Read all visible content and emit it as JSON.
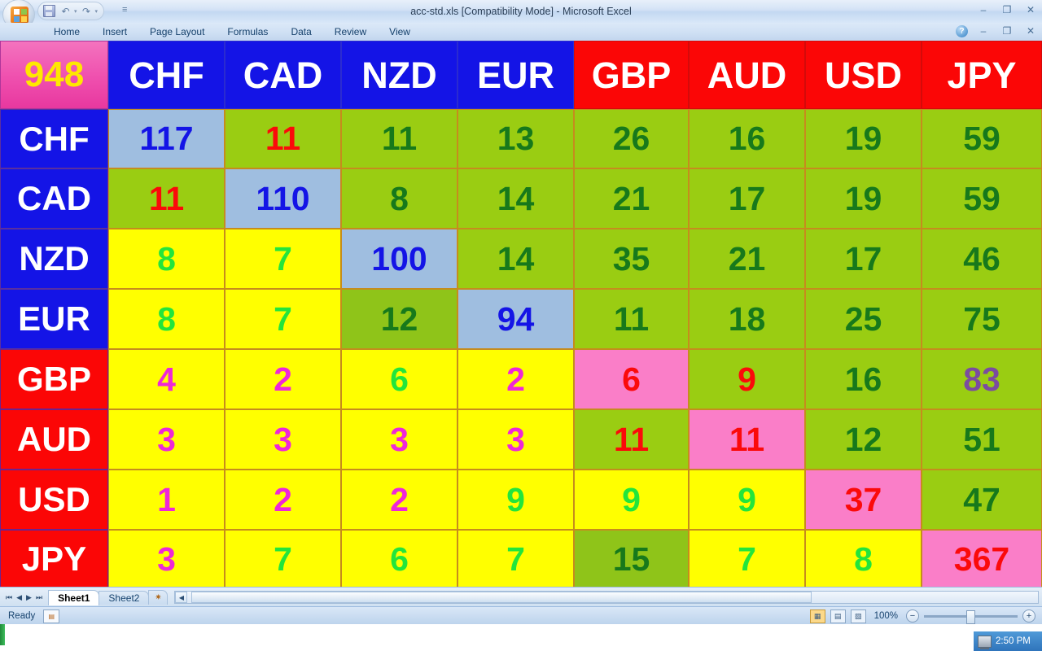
{
  "window": {
    "title": "acc-std.xls  [Compatibility Mode] - Microsoft Excel",
    "minimize": "–",
    "restore": "❐",
    "close": "✕",
    "help": "?"
  },
  "quick_access": {
    "save": "💾",
    "undo": "↶",
    "redo": "↷",
    "dropdown": "▾",
    "customize": "≡"
  },
  "ribbon": {
    "tabs": [
      {
        "label": "Home",
        "active": false
      },
      {
        "label": "Insert",
        "active": false
      },
      {
        "label": "Page Layout",
        "active": false
      },
      {
        "label": "Formulas",
        "active": false
      },
      {
        "label": "Data",
        "active": false
      },
      {
        "label": "Review",
        "active": false
      },
      {
        "label": "View",
        "active": false
      }
    ]
  },
  "chart_data": {
    "type": "table",
    "title": "948",
    "corner_label": "948",
    "categories": [
      "CHF",
      "CAD",
      "NZD",
      "EUR",
      "GBP",
      "AUD",
      "USD",
      "JPY"
    ],
    "column_headers": [
      "CHF",
      "CAD",
      "NZD",
      "EUR",
      "GBP",
      "AUD",
      "USD",
      "JPY"
    ],
    "row_headers": [
      "CHF",
      "CAD",
      "NZD",
      "EUR",
      "GBP",
      "AUD",
      "USD",
      "JPY"
    ],
    "series": [
      {
        "name": "CHF",
        "values": [
          117,
          11,
          11,
          13,
          26,
          16,
          19,
          59
        ]
      },
      {
        "name": "CAD",
        "values": [
          11,
          110,
          8,
          14,
          21,
          17,
          19,
          59
        ]
      },
      {
        "name": "NZD",
        "values": [
          8,
          7,
          100,
          14,
          35,
          21,
          17,
          46
        ]
      },
      {
        "name": "EUR",
        "values": [
          8,
          7,
          12,
          94,
          11,
          18,
          25,
          75
        ]
      },
      {
        "name": "GBP",
        "values": [
          4,
          2,
          6,
          2,
          6,
          9,
          16,
          83
        ]
      },
      {
        "name": "AUD",
        "values": [
          3,
          3,
          3,
          3,
          11,
          11,
          12,
          51
        ]
      },
      {
        "name": "USD",
        "values": [
          1,
          2,
          2,
          9,
          9,
          9,
          37,
          47
        ]
      },
      {
        "name": "JPY",
        "values": [
          3,
          7,
          6,
          7,
          15,
          7,
          8,
          367
        ]
      }
    ],
    "xlabel": "",
    "ylabel": "",
    "grid": true,
    "legend": "none"
  },
  "sheet": {
    "corner": {
      "text": "948",
      "bg": "#ef4fae",
      "fg": "#ffe800"
    },
    "col_headers": [
      {
        "text": "CHF",
        "bg": "#1414e6",
        "fg": "#ffffff"
      },
      {
        "text": "CAD",
        "bg": "#1414e6",
        "fg": "#ffffff"
      },
      {
        "text": "NZD",
        "bg": "#1414e6",
        "fg": "#ffffff"
      },
      {
        "text": "EUR",
        "bg": "#1414e6",
        "fg": "#ffffff"
      },
      {
        "text": "GBP",
        "bg": "#fb0606",
        "fg": "#ffffff"
      },
      {
        "text": "AUD",
        "bg": "#fb0606",
        "fg": "#ffffff"
      },
      {
        "text": "USD",
        "bg": "#fb0606",
        "fg": "#ffffff"
      },
      {
        "text": "JPY",
        "bg": "#fb0606",
        "fg": "#ffffff"
      }
    ],
    "rows": [
      {
        "header": {
          "text": "CHF",
          "bg": "#1414e6",
          "fg": "#ffffff"
        },
        "cells": [
          {
            "v": "117",
            "bg": "bg-blue",
            "fg": "t-blue"
          },
          {
            "v": "11",
            "bg": "bg-green",
            "fg": "t-red"
          },
          {
            "v": "11",
            "bg": "bg-green",
            "fg": "t-dgreen"
          },
          {
            "v": "13",
            "bg": "bg-green",
            "fg": "t-dgreen"
          },
          {
            "v": "26",
            "bg": "bg-green",
            "fg": "t-dgreen"
          },
          {
            "v": "16",
            "bg": "bg-green",
            "fg": "t-dgreen"
          },
          {
            "v": "19",
            "bg": "bg-green",
            "fg": "t-dgreen"
          },
          {
            "v": "59",
            "bg": "bg-green",
            "fg": "t-dgreen"
          }
        ]
      },
      {
        "header": {
          "text": "CAD",
          "bg": "#1414e6",
          "fg": "#ffffff"
        },
        "cells": [
          {
            "v": "11",
            "bg": "bg-green",
            "fg": "t-red"
          },
          {
            "v": "110",
            "bg": "bg-blue",
            "fg": "t-blue"
          },
          {
            "v": "8",
            "bg": "bg-green",
            "fg": "t-dgreen"
          },
          {
            "v": "14",
            "bg": "bg-green",
            "fg": "t-dgreen"
          },
          {
            "v": "21",
            "bg": "bg-green",
            "fg": "t-dgreen"
          },
          {
            "v": "17",
            "bg": "bg-green",
            "fg": "t-dgreen"
          },
          {
            "v": "19",
            "bg": "bg-green",
            "fg": "t-dgreen"
          },
          {
            "v": "59",
            "bg": "bg-green",
            "fg": "t-dgreen"
          }
        ]
      },
      {
        "header": {
          "text": "NZD",
          "bg": "#1414e6",
          "fg": "#ffffff"
        },
        "cells": [
          {
            "v": "8",
            "bg": "bg-yellow",
            "fg": "t-lgreen"
          },
          {
            "v": "7",
            "bg": "bg-yellow",
            "fg": "t-lgreen"
          },
          {
            "v": "100",
            "bg": "bg-blue",
            "fg": "t-blue"
          },
          {
            "v": "14",
            "bg": "bg-green",
            "fg": "t-dgreen"
          },
          {
            "v": "35",
            "bg": "bg-green",
            "fg": "t-dgreen"
          },
          {
            "v": "21",
            "bg": "bg-green",
            "fg": "t-dgreen"
          },
          {
            "v": "17",
            "bg": "bg-green",
            "fg": "t-dgreen"
          },
          {
            "v": "46",
            "bg": "bg-green",
            "fg": "t-dgreen"
          }
        ]
      },
      {
        "header": {
          "text": "EUR",
          "bg": "#1414e6",
          "fg": "#ffffff"
        },
        "cells": [
          {
            "v": "8",
            "bg": "bg-yellow",
            "fg": "t-lgreen"
          },
          {
            "v": "7",
            "bg": "bg-yellow",
            "fg": "t-lgreen"
          },
          {
            "v": "12",
            "bg": "bg-green2",
            "fg": "t-dgreen"
          },
          {
            "v": "94",
            "bg": "bg-blue",
            "fg": "t-blue"
          },
          {
            "v": "11",
            "bg": "bg-green",
            "fg": "t-dgreen"
          },
          {
            "v": "18",
            "bg": "bg-green",
            "fg": "t-dgreen"
          },
          {
            "v": "25",
            "bg": "bg-green",
            "fg": "t-dgreen"
          },
          {
            "v": "75",
            "bg": "bg-green",
            "fg": "t-dgreen"
          }
        ]
      },
      {
        "header": {
          "text": "GBP",
          "bg": "#fb0606",
          "fg": "#ffffff"
        },
        "cells": [
          {
            "v": "4",
            "bg": "bg-yellow",
            "fg": "t-magenta"
          },
          {
            "v": "2",
            "bg": "bg-yellow",
            "fg": "t-magenta"
          },
          {
            "v": "6",
            "bg": "bg-yellow",
            "fg": "t-lgreen"
          },
          {
            "v": "2",
            "bg": "bg-yellow",
            "fg": "t-magenta"
          },
          {
            "v": "6",
            "bg": "bg-pink",
            "fg": "t-red"
          },
          {
            "v": "9",
            "bg": "bg-green",
            "fg": "t-red"
          },
          {
            "v": "16",
            "bg": "bg-green",
            "fg": "t-dgreen"
          },
          {
            "v": "83",
            "bg": "bg-green",
            "fg": "t-purple"
          }
        ]
      },
      {
        "header": {
          "text": "AUD",
          "bg": "#fb0606",
          "fg": "#ffffff"
        },
        "cells": [
          {
            "v": "3",
            "bg": "bg-yellow",
            "fg": "t-magenta"
          },
          {
            "v": "3",
            "bg": "bg-yellow",
            "fg": "t-magenta"
          },
          {
            "v": "3",
            "bg": "bg-yellow",
            "fg": "t-magenta"
          },
          {
            "v": "3",
            "bg": "bg-yellow",
            "fg": "t-magenta"
          },
          {
            "v": "11",
            "bg": "bg-green",
            "fg": "t-red"
          },
          {
            "v": "11",
            "bg": "bg-pink",
            "fg": "t-red"
          },
          {
            "v": "12",
            "bg": "bg-green",
            "fg": "t-dgreen"
          },
          {
            "v": "51",
            "bg": "bg-green",
            "fg": "t-dgreen"
          }
        ]
      },
      {
        "header": {
          "text": "USD",
          "bg": "#fb0606",
          "fg": "#ffffff"
        },
        "cells": [
          {
            "v": "1",
            "bg": "bg-yellow",
            "fg": "t-magenta"
          },
          {
            "v": "2",
            "bg": "bg-yellow",
            "fg": "t-magenta"
          },
          {
            "v": "2",
            "bg": "bg-yellow",
            "fg": "t-magenta"
          },
          {
            "v": "9",
            "bg": "bg-yellow",
            "fg": "t-lgreen"
          },
          {
            "v": "9",
            "bg": "bg-yellow",
            "fg": "t-lgreen"
          },
          {
            "v": "9",
            "bg": "bg-yellow",
            "fg": "t-lgreen"
          },
          {
            "v": "37",
            "bg": "bg-pink",
            "fg": "t-red"
          },
          {
            "v": "47",
            "bg": "bg-green",
            "fg": "t-dgreen"
          }
        ]
      },
      {
        "header": {
          "text": "JPY",
          "bg": "#fb0606",
          "fg": "#ffffff"
        },
        "cells": [
          {
            "v": "3",
            "bg": "bg-yellow",
            "fg": "t-magenta"
          },
          {
            "v": "7",
            "bg": "bg-yellow",
            "fg": "t-lgreen"
          },
          {
            "v": "6",
            "bg": "bg-yellow",
            "fg": "t-lgreen"
          },
          {
            "v": "7",
            "bg": "bg-yellow",
            "fg": "t-lgreen"
          },
          {
            "v": "15",
            "bg": "bg-green2",
            "fg": "t-dgreen"
          },
          {
            "v": "7",
            "bg": "bg-yellow",
            "fg": "t-lgreen"
          },
          {
            "v": "8",
            "bg": "bg-yellow",
            "fg": "t-lgreen"
          },
          {
            "v": "367",
            "bg": "bg-pink",
            "fg": "t-red"
          }
        ]
      }
    ]
  },
  "sheet_tabs": {
    "first": "⏮",
    "prev": "◀",
    "next": "▶",
    "last": "⏭",
    "tabs": [
      {
        "label": "Sheet1",
        "active": true
      },
      {
        "label": "Sheet2",
        "active": false
      }
    ],
    "new_sheet": "✷"
  },
  "status": {
    "ready": "Ready",
    "macro_icon": "▤",
    "zoom": "100%",
    "zoom_out": "−",
    "zoom_in": "+",
    "view_normal": "▦",
    "view_layout": "▤",
    "view_break": "▧"
  },
  "taskbar": {
    "clock": "2:50 PM"
  }
}
